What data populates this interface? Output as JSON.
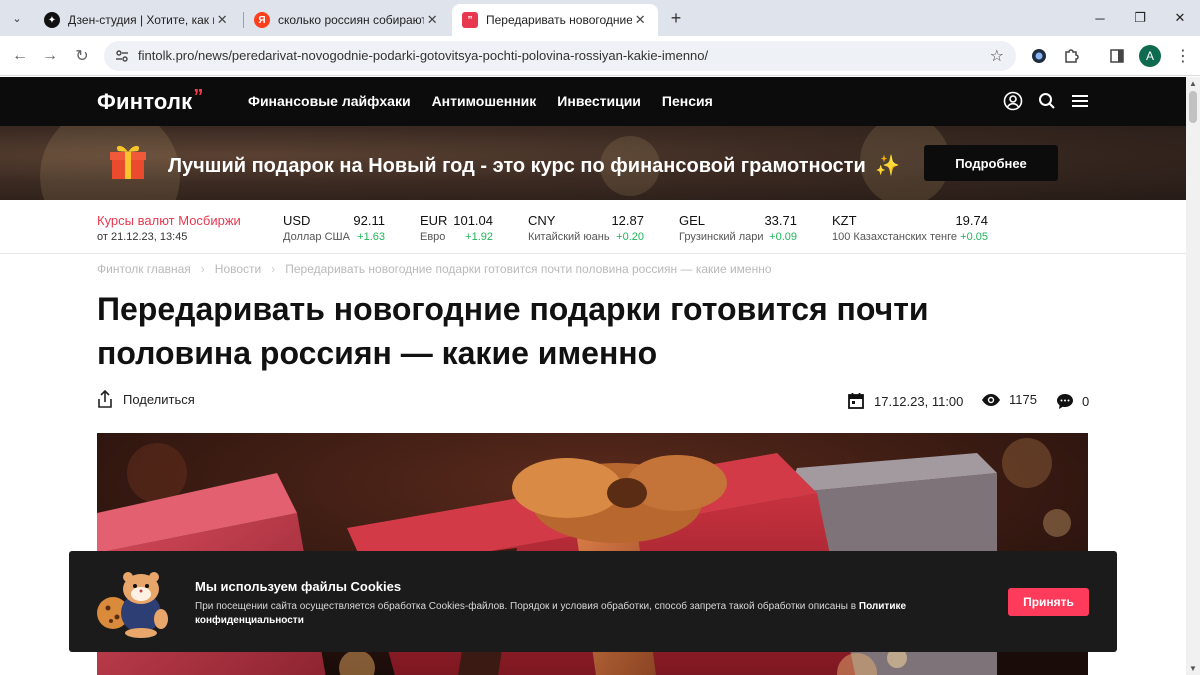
{
  "browser": {
    "tabs": [
      {
        "title": "Дзен-студия | Хотите, как во…",
        "favicon": "zen-icon"
      },
      {
        "title": "сколько россиян собираются…",
        "favicon": "yandex-icon"
      },
      {
        "title": "Передаривать новогодние по…",
        "favicon": "fintolk-icon"
      }
    ],
    "active_tab": 2,
    "url": "fintolk.pro/news/peredarivat-novogodnie-podarki-gotovitsya-pochti-polovina-rossiyan-kakie-imenno/",
    "profile_initial": "A"
  },
  "site": {
    "logo": "Финтолк",
    "logo_mark": "”",
    "nav": [
      "Финансовые лайфхаки",
      "Антимошенник",
      "Инвестиции",
      "Пенсия"
    ]
  },
  "promo": {
    "text": "Лучший подарок на Новый год - это курс по финансовой грамотности",
    "sparkle": "✨",
    "button": "Подробнее"
  },
  "fx": {
    "title": "Курсы валют Мосбиржи",
    "date": "от 21.12.23, 13:45",
    "items": [
      {
        "code": "USD",
        "value": "92.11",
        "name": "Доллар США",
        "change": "+1.63"
      },
      {
        "code": "EUR",
        "value": "101.04",
        "name": "Евро",
        "change": "+1.92"
      },
      {
        "code": "CNY",
        "value": "12.87",
        "name": "Китайский юань",
        "change": "+0.20"
      },
      {
        "code": "GEL",
        "value": "33.71",
        "name": "Грузинский лари",
        "change": "+0.09"
      },
      {
        "code": "KZT",
        "value": "19.74",
        "name": "100 Казахстанских тенге",
        "change": "+0.05"
      }
    ]
  },
  "breadcrumb": {
    "home": "Финтолк главная",
    "section": "Новости",
    "current": "Передаривать новогодние подарки готовится почти половина россиян — какие именно",
    "sep": "›"
  },
  "article": {
    "title": "Передаривать новогодние подарки готовится почти половина россиян — какие именно",
    "share": "Поделиться",
    "date": "17.12.23, 11:00",
    "views": "1175",
    "comments": "0"
  },
  "cookie": {
    "title": "Мы используем файлы Cookies",
    "text": "При посещении сайта осуществляется обработка Cookies-файлов. Порядок и условия обработки, способ запрета такой обработки описаны в",
    "link": "Политике конфиденциальности",
    "button": "Принять"
  },
  "colors": {
    "accent_red": "#ff3b5c",
    "fx_title": "#e8384f",
    "fx_change": "#1fb35a",
    "header_bg": "#0c0c0c"
  }
}
